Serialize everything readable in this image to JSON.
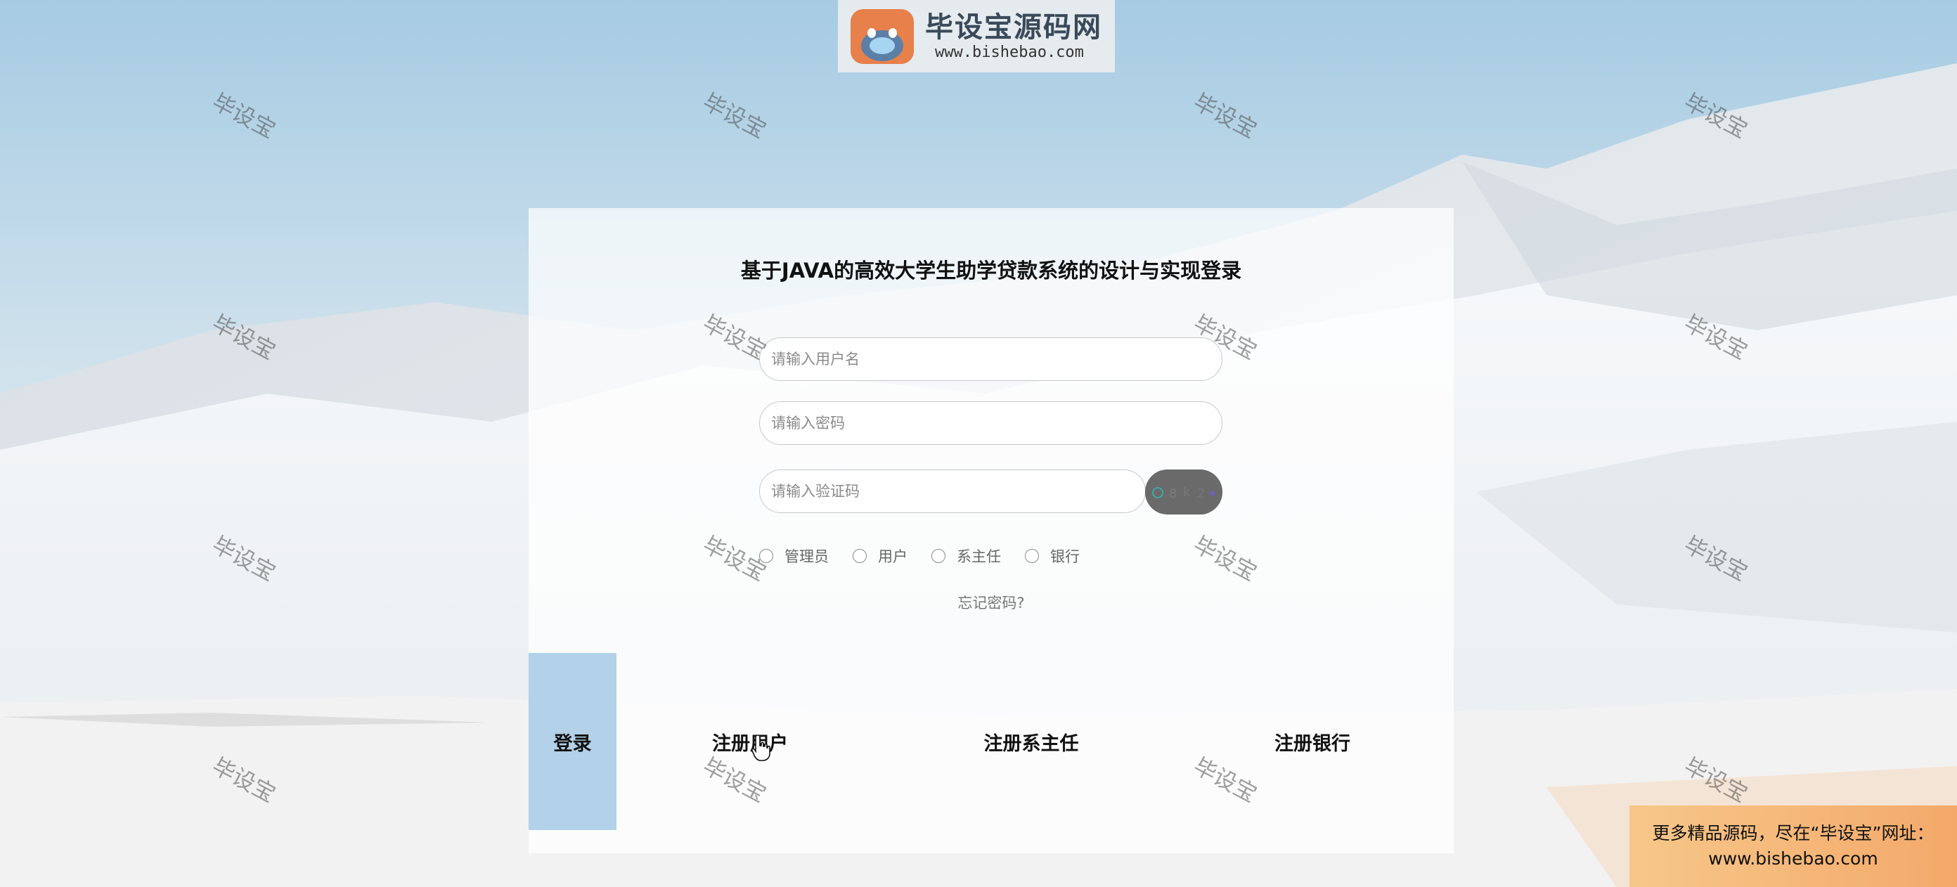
{
  "logo": {
    "badge": "毕设宝",
    "title": "毕设宝源码网",
    "url": "www.bishebao.com"
  },
  "login": {
    "title": "基于JAVA的高效大学生助学贷款系统的设计与实现登录",
    "username_placeholder": "请输入用户名",
    "password_placeholder": "请输入密码",
    "captcha_placeholder": "请输入验证码",
    "roles": [
      "管理员",
      "用户",
      "系主任",
      "银行"
    ],
    "forgot": "忘记密码?",
    "buttons": {
      "login": "登录",
      "register_user": "注册用户",
      "register_dean": "注册系主任",
      "register_bank": "注册银行"
    }
  },
  "watermark": "毕设宝",
  "promo": {
    "line1": "更多精品源码，尽在“毕设宝”网址：",
    "line2": "www.bishebao.com"
  },
  "colors": {
    "login_button": "#b3d1e8",
    "captcha_bg": "#6a6a6a",
    "promo": "#f3a96a"
  }
}
